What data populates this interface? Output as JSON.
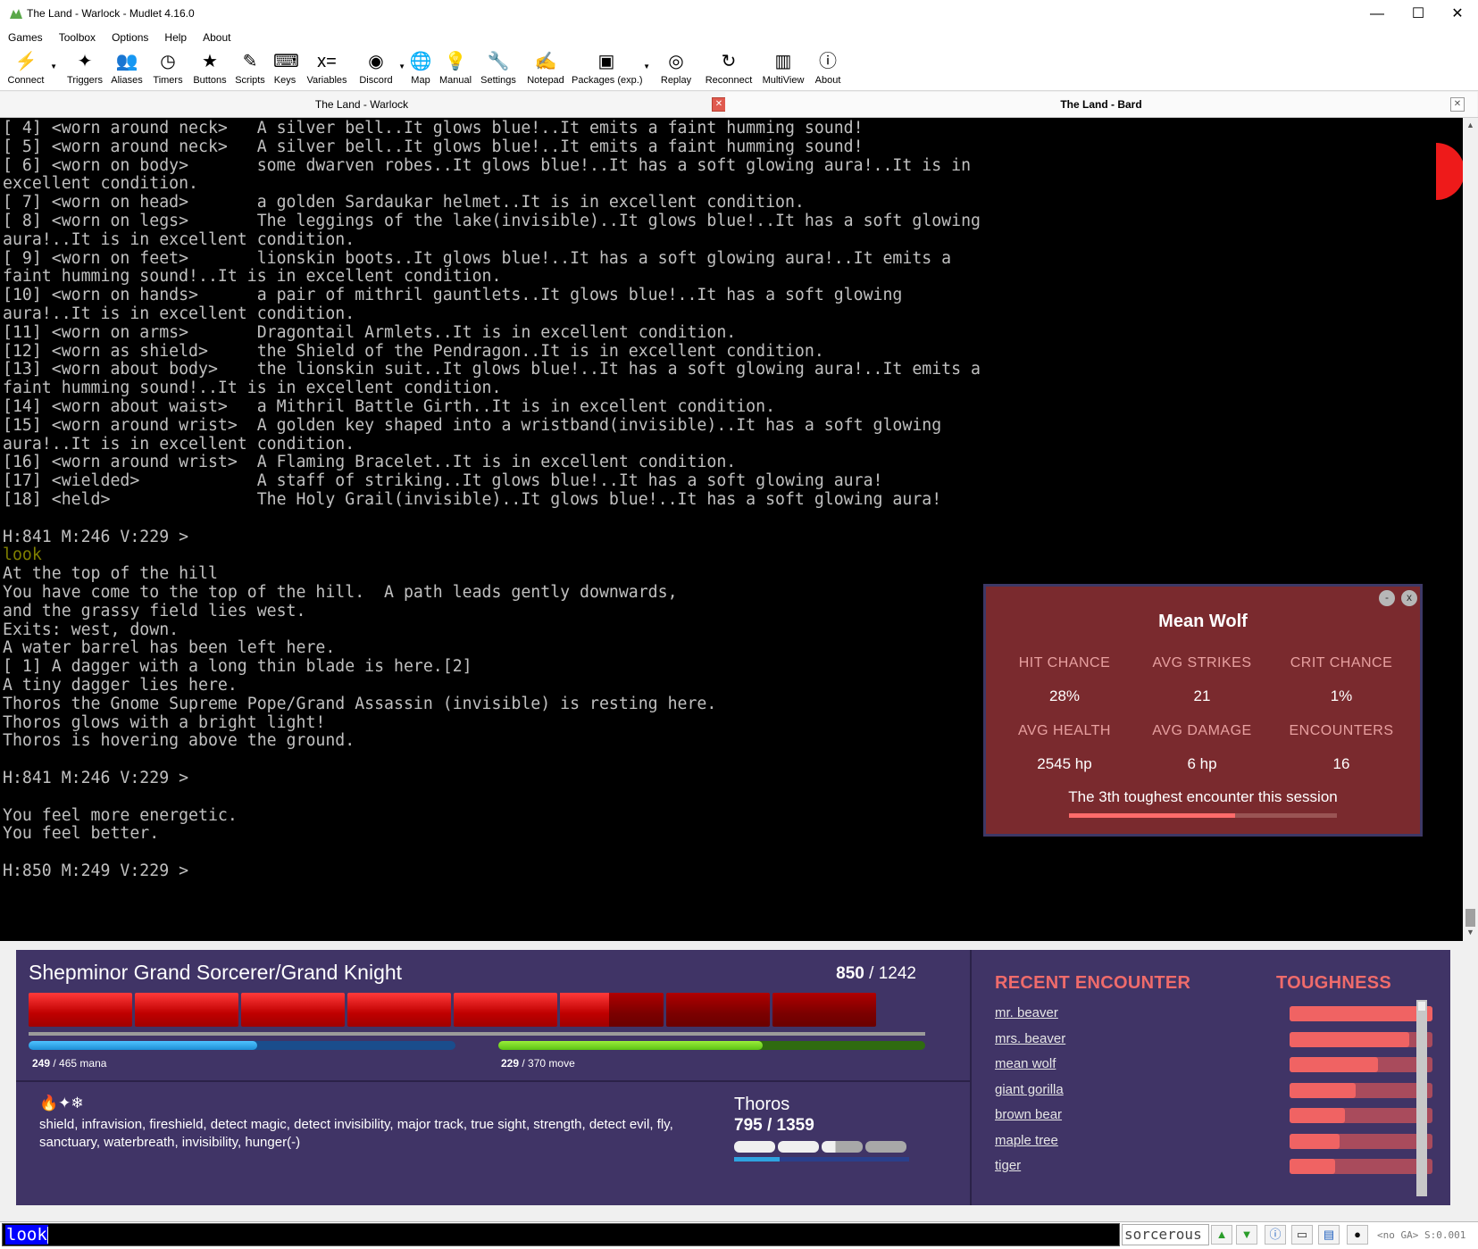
{
  "window": {
    "title": "The Land - Warlock - Mudlet 4.16.0",
    "minimize": "—",
    "maximize": "☐",
    "close": "✕"
  },
  "menu": [
    "Games",
    "Toolbox",
    "Options",
    "Help",
    "About"
  ],
  "toolbar": [
    {
      "label": "Connect",
      "icon": "connect-icon",
      "glyph": "⚡"
    },
    {
      "label": "Triggers",
      "icon": "triggers-icon",
      "glyph": "✦"
    },
    {
      "label": "Aliases",
      "icon": "aliases-icon",
      "glyph": "👥"
    },
    {
      "label": "Timers",
      "icon": "timers-icon",
      "glyph": "◷"
    },
    {
      "label": "Buttons",
      "icon": "buttons-icon",
      "glyph": "★"
    },
    {
      "label": "Scripts",
      "icon": "scripts-icon",
      "glyph": "✎"
    },
    {
      "label": "Keys",
      "icon": "keys-icon",
      "glyph": "⌨"
    },
    {
      "label": "Variables",
      "icon": "variables-icon",
      "glyph": "x="
    },
    {
      "label": "Discord",
      "icon": "discord-icon",
      "glyph": "◉"
    },
    {
      "label": "Map",
      "icon": "map-icon",
      "glyph": "🌐"
    },
    {
      "label": "Manual",
      "icon": "manual-icon",
      "glyph": "💡"
    },
    {
      "label": "Settings",
      "icon": "settings-icon",
      "glyph": "🔧"
    },
    {
      "label": "Notepad",
      "icon": "notepad-icon",
      "glyph": "✍"
    },
    {
      "label": "Packages (exp.)",
      "icon": "packages-icon",
      "glyph": "▣"
    },
    {
      "label": "Replay",
      "icon": "replay-icon",
      "glyph": "◎"
    },
    {
      "label": "Reconnect",
      "icon": "reconnect-icon",
      "glyph": "↻"
    },
    {
      "label": "MultiView",
      "icon": "multiview-icon",
      "glyph": "▥"
    },
    {
      "label": "About",
      "icon": "about-icon",
      "glyph": "ⓘ"
    }
  ],
  "tabs": [
    {
      "label": "The Land - Warlock",
      "close": "✕"
    },
    {
      "label": "The Land - Bard",
      "close": "✕"
    }
  ],
  "console": {
    "lines": [
      "[ 4] <worn around neck>   A silver bell..It glows blue!..It emits a faint humming sound!",
      "[ 5] <worn around neck>   A silver bell..It glows blue!..It emits a faint humming sound!",
      "[ 6] <worn on body>       some dwarven robes..It glows blue!..It has a soft glowing aura!..It is in",
      "excellent condition.",
      "[ 7] <worn on head>       a golden Sardaukar helmet..It is in excellent condition.",
      "[ 8] <worn on legs>       The leggings of the lake(invisible)..It glows blue!..It has a soft glowing",
      "aura!..It is in excellent condition.",
      "[ 9] <worn on feet>       lionskin boots..It glows blue!..It has a soft glowing aura!..It emits a",
      "faint humming sound!..It is in excellent condition.",
      "[10] <worn on hands>      a pair of mithril gauntlets..It glows blue!..It has a soft glowing",
      "aura!..It is in excellent condition.",
      "[11] <worn on arms>       Dragontail Armlets..It is in excellent condition.",
      "[12] <worn as shield>     the Shield of the Pendragon..It is in excellent condition.",
      "[13] <worn about body>    the lionskin suit..It glows blue!..It has a soft glowing aura!..It emits a",
      "faint humming sound!..It is in excellent condition.",
      "[14] <worn about waist>   a Mithril Battle Girth..It is in excellent condition.",
      "[15] <worn around wrist>  A golden key shaped into a wristband(invisible)..It has a soft glowing",
      "aura!..It is in excellent condition.",
      "[16] <worn around wrist>  A Flaming Bracelet..It is in excellent condition.",
      "[17] <wielded>            A staff of striking..It glows blue!..It has a soft glowing aura!",
      "[18] <held>               The Holy Grail(invisible)..It glows blue!..It has a soft glowing aura!",
      "",
      "H:841 M:246 V:229 >",
      "look",
      "At the top of the hill",
      "You have come to the top of the hill.  A path leads gently downwards,",
      "and the grassy field lies west.",
      "Exits: west, down.",
      "A water barrel has been left here.",
      "[ 1] A dagger with a long thin blade is here.[2]",
      "A tiny dagger lies here.",
      "Thoros the Gnome Supreme Pope/Grand Assassin (invisible) is resting here.",
      "Thoros glows with a bright light!",
      "Thoros is hovering above the ground.",
      "",
      "H:841 M:246 V:229 >",
      "",
      "You feel more energetic.",
      "You feel better.",
      "",
      "H:850 M:249 V:229 >"
    ],
    "command_line_index": 23
  },
  "encounter": {
    "title": "Mean Wolf",
    "minimize": "-",
    "close": "x",
    "stats": [
      {
        "label": "HIT CHANCE",
        "value": "28%"
      },
      {
        "label": "AVG STRIKES",
        "value": "21"
      },
      {
        "label": "CRIT CHANCE",
        "value": "1%"
      },
      {
        "label": "AVG HEALTH",
        "value": "2545 hp"
      },
      {
        "label": "AVG DAMAGE",
        "value": "6 hp"
      },
      {
        "label": "ENCOUNTERS",
        "value": "16"
      }
    ],
    "note": "The 3th toughest encounter this session",
    "toughness_fraction": 0.62
  },
  "character": {
    "name": "Shepminor Grand Sorcerer/Grand Knight",
    "hp": "850",
    "hp_sep": " / ",
    "hp_max": "1242",
    "hp_value": 850,
    "hp_max_value": 1242,
    "mana": "249",
    "mana_max": "465 mana",
    "mana_value": 249,
    "mana_max_value": 465,
    "move": "229",
    "move_max": "370 move",
    "move_value": 229,
    "move_max_value": 370,
    "sep": " / "
  },
  "affects": {
    "icons": "🔥✦❄",
    "text": "shield, infravision, fireshield, detect magic, detect invisibility, major track, true sight, strength, detect evil, fly, sanctuary, waterbreath, invisibility, hunger(-)"
  },
  "target": {
    "name": "Thoros",
    "hp": "795 / 1359",
    "hp_fraction": 0.585,
    "blue_fraction": 0.26
  },
  "recent": {
    "heading": "RECENT ENCOUNTER",
    "toughness_heading": "TOUGHNESS",
    "items": [
      {
        "name": "mr. beaver",
        "toughness": 1.0
      },
      {
        "name": "mrs. beaver",
        "toughness": 0.84
      },
      {
        "name": "mean wolf",
        "toughness": 0.62
      },
      {
        "name": "giant gorilla",
        "toughness": 0.46
      },
      {
        "name": "brown bear",
        "toughness": 0.39
      },
      {
        "name": "maple tree",
        "toughness": 0.35
      },
      {
        "name": "tiger",
        "toughness": 0.32
      }
    ]
  },
  "input": {
    "command": "look",
    "side_command": "sorcerous",
    "status": "<no GA> S:0.001"
  },
  "colors": {
    "console_bg": "#000000",
    "console_text": "#c0c0c0",
    "command_echo": "#7f7f00",
    "panel_bg": "#403466",
    "encounter_bg": "#7a2a2e",
    "accent_red": "#ef6b6b"
  }
}
